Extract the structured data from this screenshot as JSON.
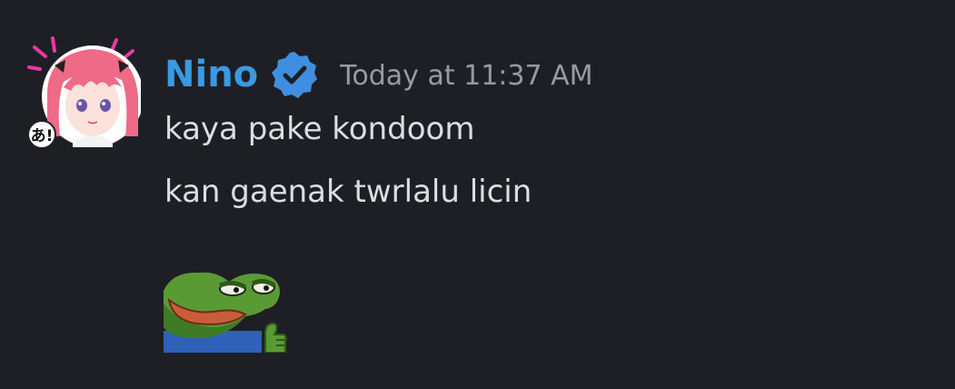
{
  "message": {
    "author": {
      "username": "Nino",
      "badge": "verified-icon",
      "name_color": "#3a99e0"
    },
    "timestamp": "Today at 11:37 AM",
    "lines": [
      "kaya pake kondoom",
      "kan gaenak twrlalu licin"
    ],
    "avatar": "anime-avatar-pink-hair",
    "sticker": "pepe-frog-thumbs-up-sticker"
  },
  "colors": {
    "background": "#1e1f24",
    "text": "#dbdee1",
    "timestamp": "#949ba4",
    "verified_badge": "#3f8fe0"
  }
}
